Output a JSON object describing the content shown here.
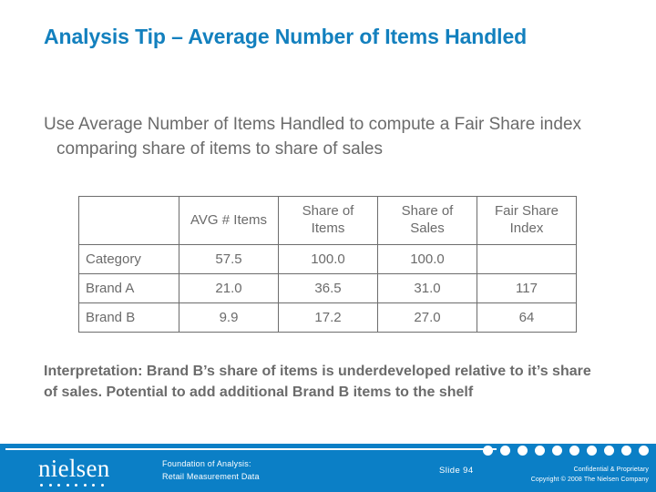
{
  "slide": {
    "title": "Analysis Tip – Average Number of Items Handled",
    "body": "Use Average Number of Items Handled to compute a Fair Share index comparing share of items to share of sales",
    "interpretation": "Interpretation: Brand B’s share of items is underdeveloped relative to it’s share of sales.  Potential to add additional Brand B items to the shelf"
  },
  "table": {
    "headers": [
      "",
      "AVG # Items",
      "Share of Items",
      "Share of Sales",
      "Fair Share Index"
    ],
    "rows": [
      {
        "label": "Category",
        "avg_items": "57.5",
        "share_items": "100.0",
        "share_sales": "100.0",
        "fair_share_index": ""
      },
      {
        "label": "Brand A",
        "avg_items": "21.0",
        "share_items": "36.5",
        "share_sales": "31.0",
        "fair_share_index": "117"
      },
      {
        "label": "Brand B",
        "avg_items": "9.9",
        "share_items": "17.2",
        "share_sales": "27.0",
        "fair_share_index": "64"
      }
    ]
  },
  "footer": {
    "logo_text": "nielsen",
    "deck_line1": "Foundation of Analysis:",
    "deck_line2": "Retail Measurement Data",
    "slide_number": "Slide  94",
    "confidential_line1": "Confidential & Proprietary",
    "confidential_line2": "Copyright © 2008 The Nielsen Company",
    "dot_count": 10,
    "logo_dot_count": 8
  },
  "colors": {
    "title_blue": "#1380be",
    "footer_blue": "#0b7fc6",
    "accent_red": "#a02128",
    "body_gray": "#6b6b6b"
  }
}
